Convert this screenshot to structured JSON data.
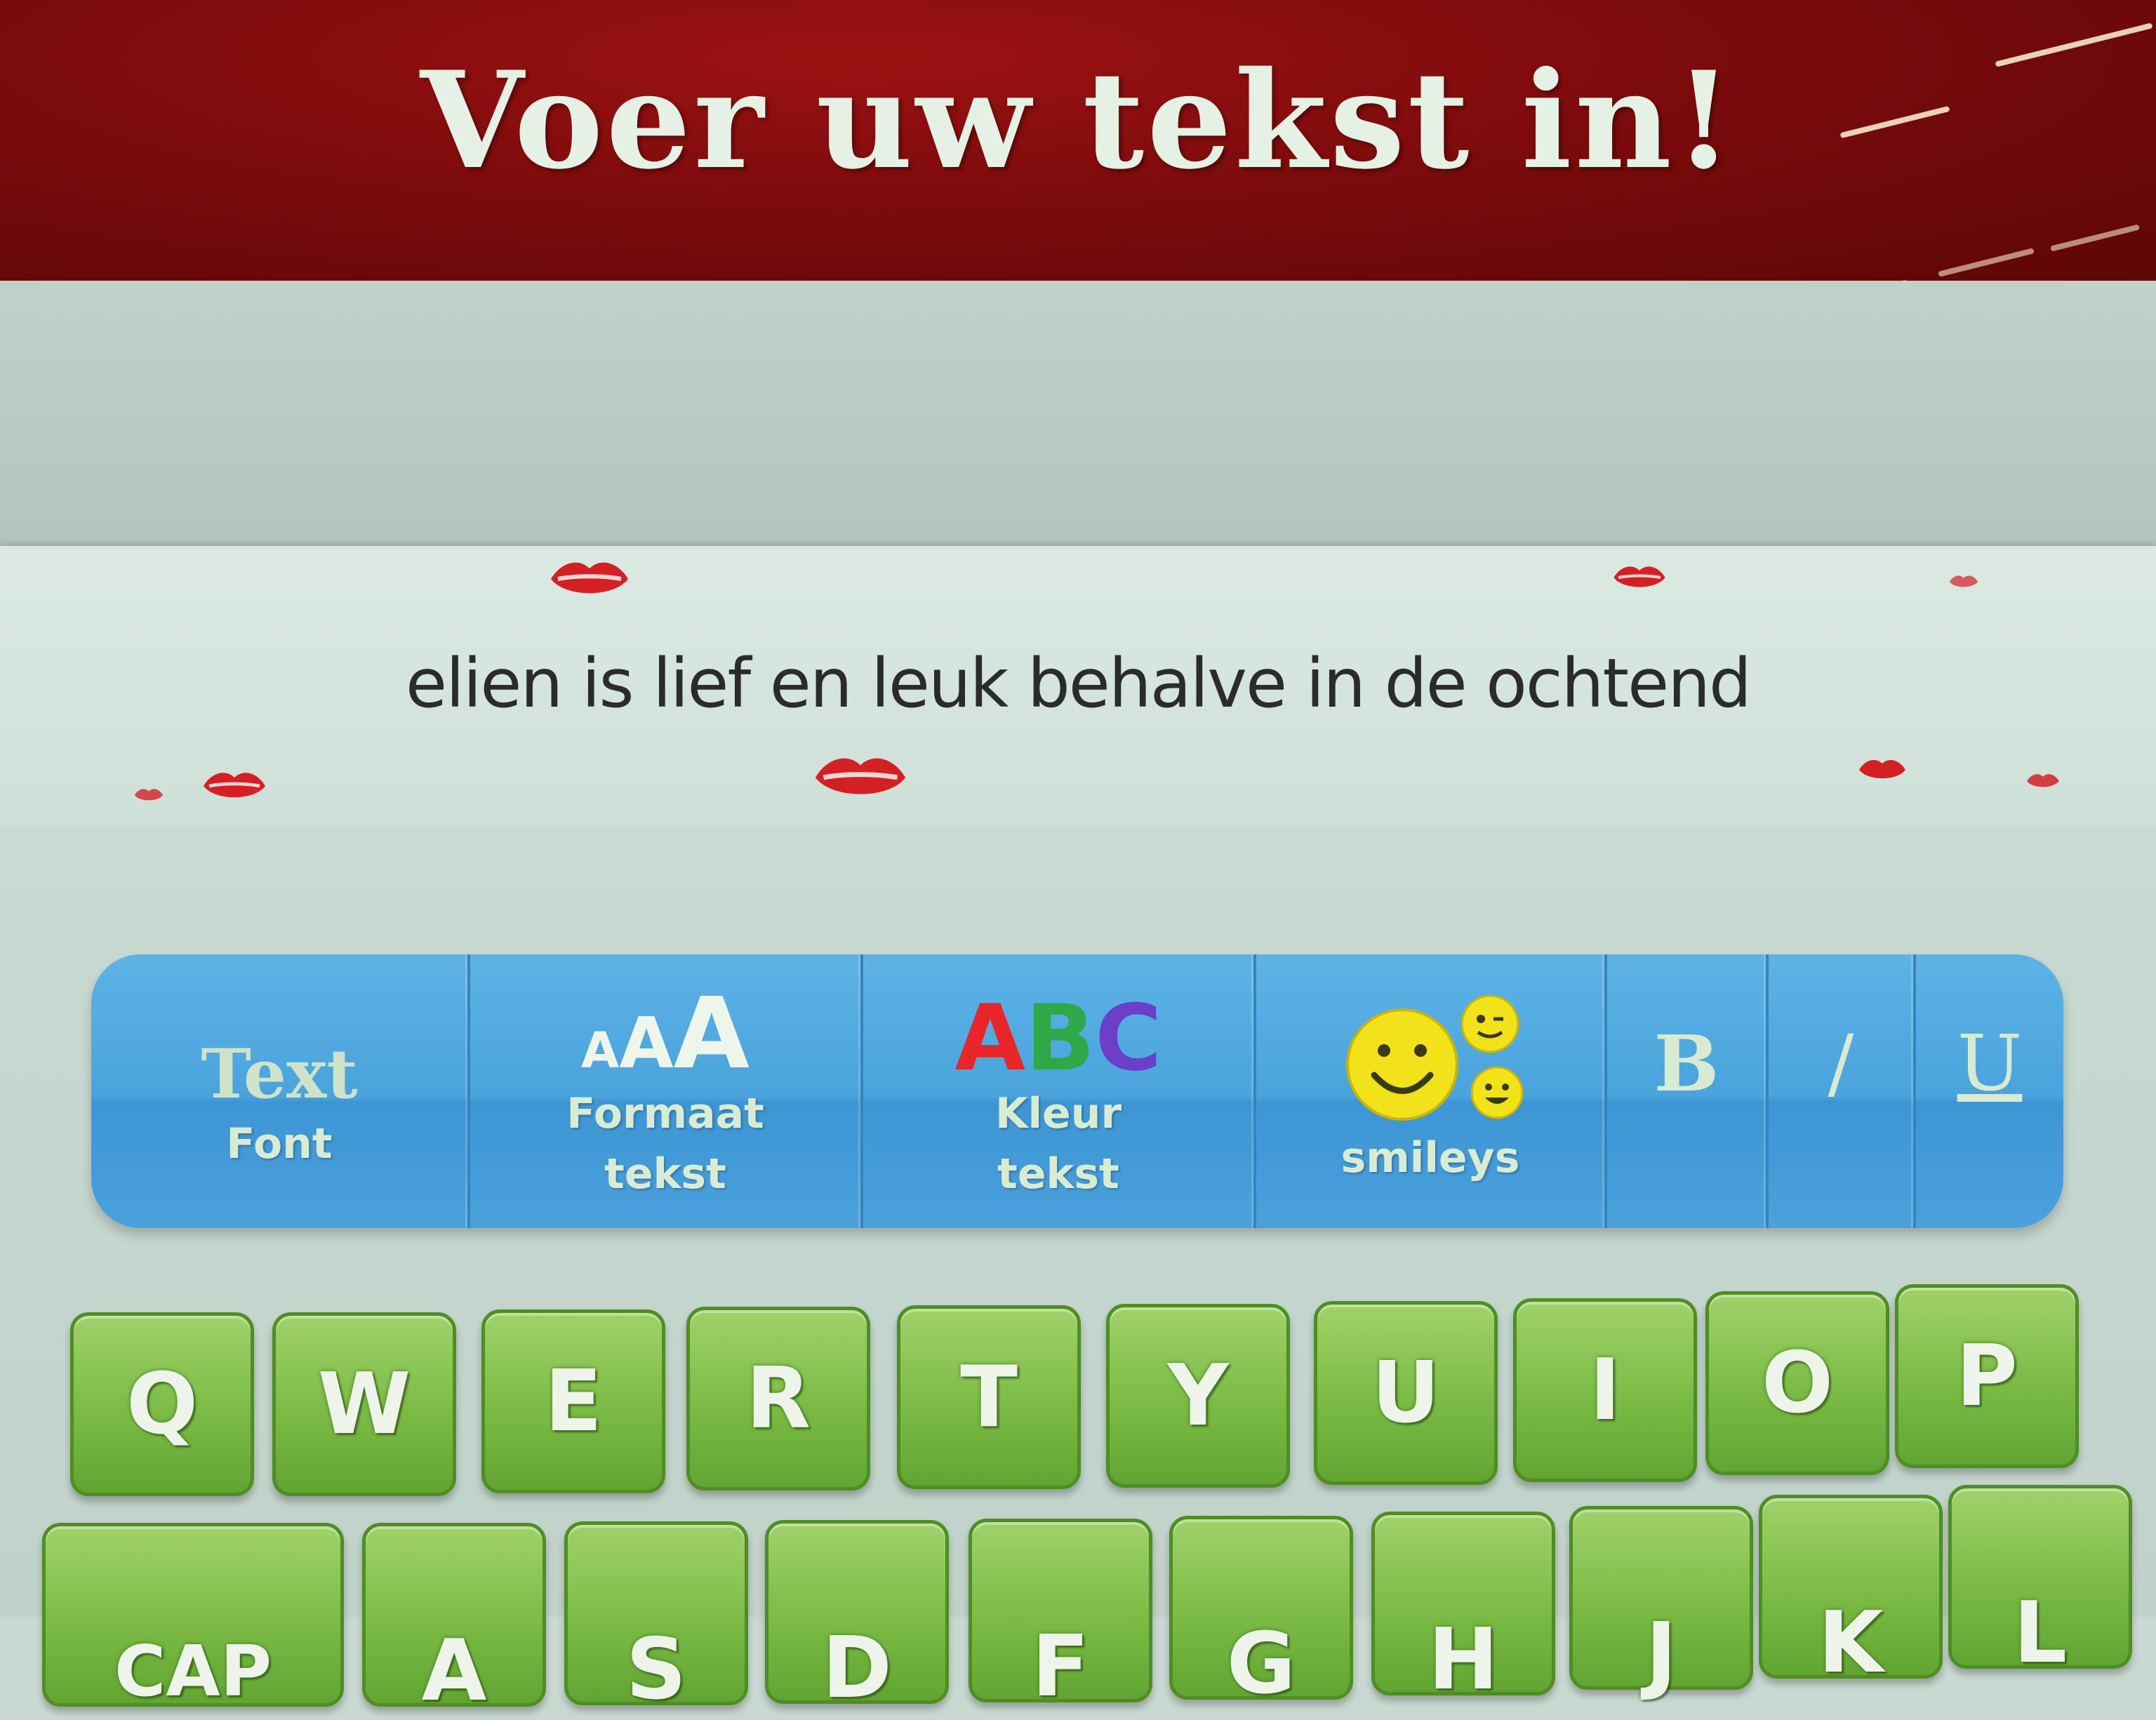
{
  "header": {
    "title": "Voer uw tekst in!"
  },
  "preview": {
    "text": "elien is lief en leuk behalve in de ochtend"
  },
  "toolbar": {
    "font": {
      "icon_text": "Text",
      "label": "Font"
    },
    "format": {
      "icon_text": "AAA",
      "label": "Formaat\ntekst"
    },
    "color": {
      "icon_text": "ABC",
      "label": "Kleur\ntekst"
    },
    "smileys": {
      "label": "smileys"
    },
    "bold": "B",
    "italic": "/",
    "underline": "U"
  },
  "keyboard": {
    "row1": [
      "Q",
      "W",
      "E",
      "R",
      "T",
      "Y",
      "U",
      "I",
      "O",
      "P"
    ],
    "row2": [
      "CAP",
      "A",
      "S",
      "D",
      "F",
      "G",
      "H",
      "J",
      "K",
      "L"
    ]
  },
  "colors": {
    "header_red": "#7c0b0c",
    "title_text": "#e4f1e4",
    "toolbar_blue": "#4aa3dc",
    "key_green": "#7bbb45",
    "lips_red": "#d42025",
    "abc_colors": [
      "#e8262a",
      "#2fa84a",
      "#2f5fd0"
    ]
  }
}
